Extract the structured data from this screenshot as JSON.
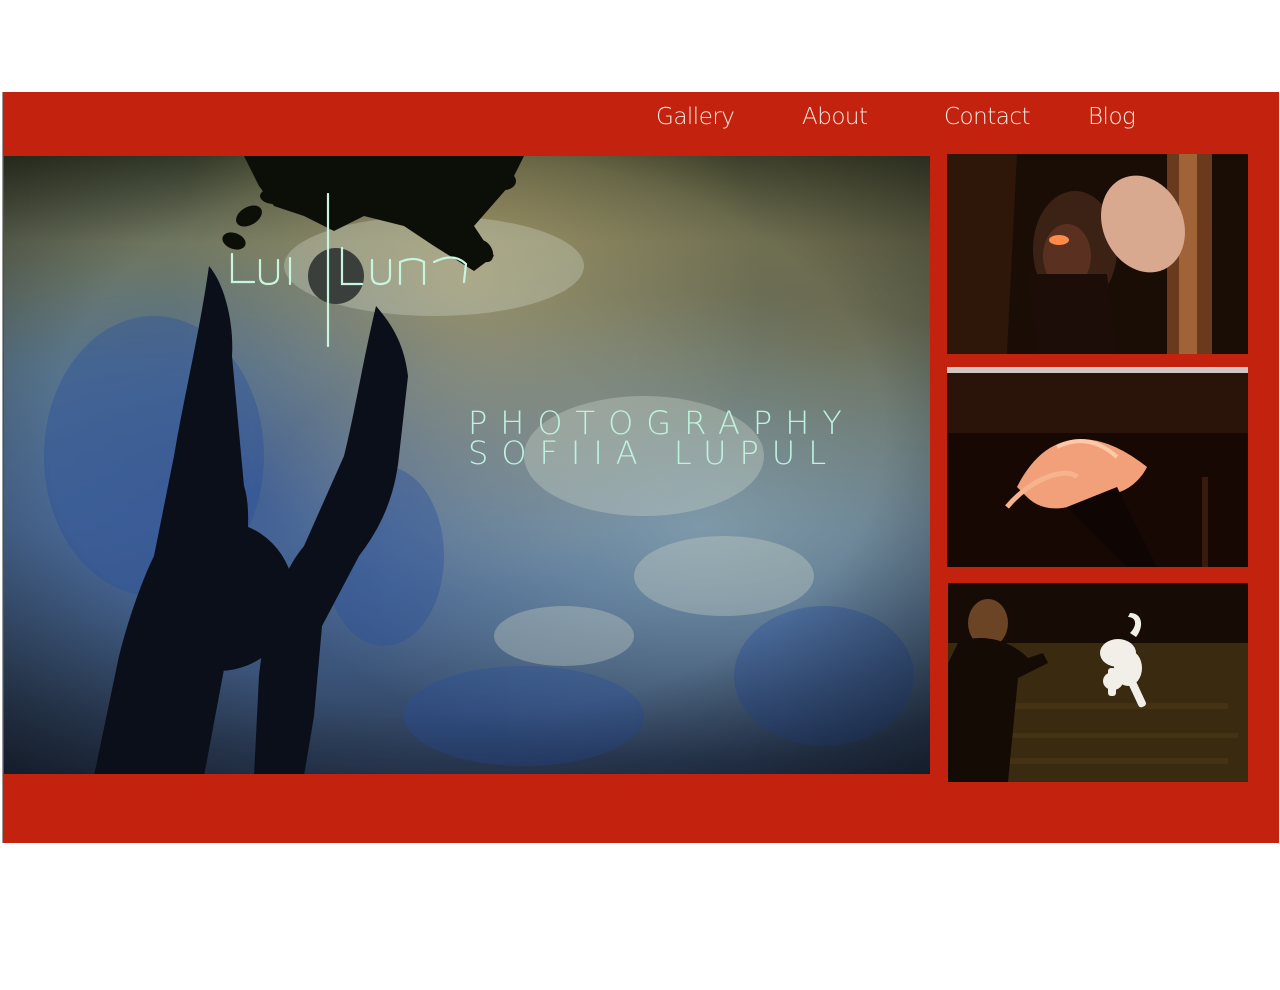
{
  "nav": {
    "items": [
      {
        "label": "Gallery"
      },
      {
        "label": "About"
      },
      {
        "label": "Contact"
      },
      {
        "label": "Blog"
      }
    ]
  },
  "hero": {
    "logo_text": "lupul",
    "title_line1": "PHOTOGRAPHY",
    "title_line2": "SOFIIA LUPUL"
  },
  "colors": {
    "brand_red": "#c3230e",
    "nav_text": "#f6e9df",
    "title_text": "#bff2de"
  },
  "thumbnails": [
    {
      "name": "girl-with-hat-photo"
    },
    {
      "name": "flying-hair-photo"
    },
    {
      "name": "girl-with-white-dog-photo"
    }
  ]
}
